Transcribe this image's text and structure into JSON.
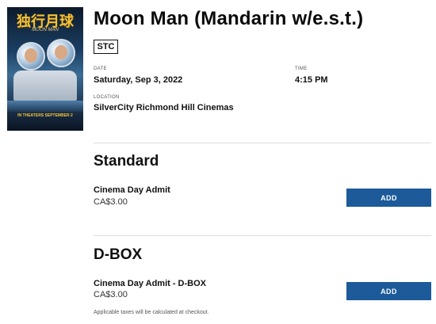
{
  "poster": {
    "title_art": "独行月球",
    "subtitle_art": "MOON MAN",
    "bottom_art": "IN THEATERS SEPTEMBER 2"
  },
  "movie": {
    "title": "Moon Man (Mandarin w/e.s.t.)",
    "badge": "STC"
  },
  "details": {
    "date_label": "DATE",
    "date_value": "Saturday, Sep 3, 2022",
    "time_label": "TIME",
    "time_value": "4:15 PM",
    "location_label": "LOCATION",
    "location_value": "SilverCity Richmond Hill Cinemas"
  },
  "sections": [
    {
      "title": "Standard",
      "ticket_name": "Cinema Day Admit",
      "ticket_price": "CA$3.00",
      "button_label": "ADD"
    },
    {
      "title": "D-BOX",
      "ticket_name": "Cinema Day Admit - D-BOX",
      "ticket_price": "CA$3.00",
      "button_label": "ADD"
    }
  ],
  "footnote": "Applicable taxes will be calculated at checkout.",
  "colors": {
    "accent": "#1c5a9a",
    "divider": "#dedede"
  }
}
